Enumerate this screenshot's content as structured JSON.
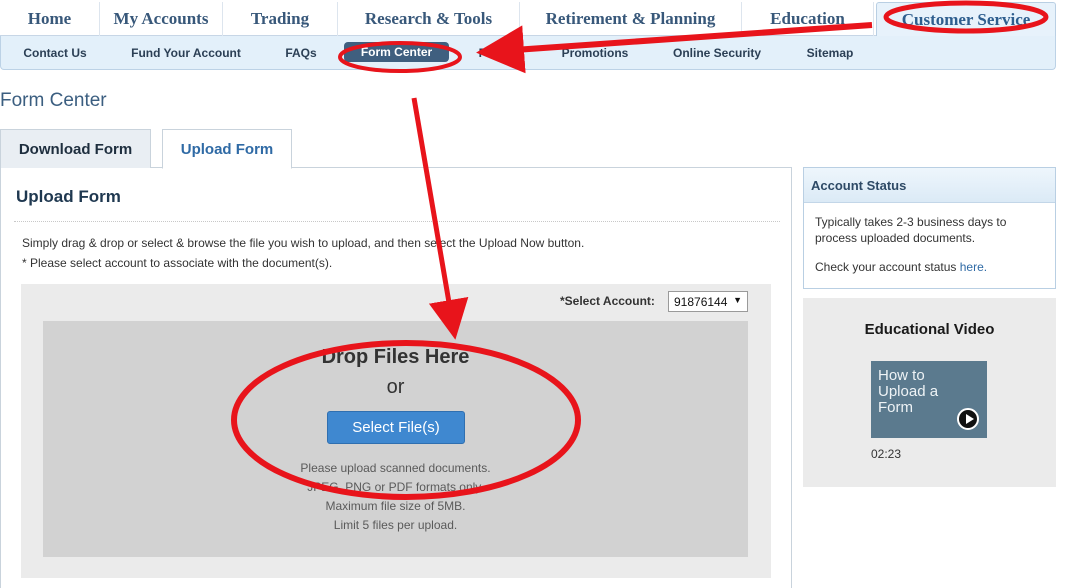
{
  "main_nav": {
    "items": [
      {
        "label": "Home"
      },
      {
        "label": "My Accounts"
      },
      {
        "label": "Trading"
      },
      {
        "label": "Research & Tools"
      },
      {
        "label": "Retirement & Planning"
      },
      {
        "label": "Education"
      },
      {
        "label": "Customer Service",
        "active": true
      }
    ]
  },
  "sub_nav": {
    "items": [
      {
        "label": "Contact Us"
      },
      {
        "label": "Fund Your Account"
      },
      {
        "label": "FAQs"
      },
      {
        "label": "Form Center",
        "active": true
      },
      {
        "label": "Pricing"
      },
      {
        "label": "Promotions"
      },
      {
        "label": "Online Security"
      },
      {
        "label": "Sitemap"
      }
    ]
  },
  "page": {
    "title": "Form Center",
    "tabs": [
      {
        "label": "Download Form"
      },
      {
        "label": "Upload Form",
        "active": true
      }
    ]
  },
  "upload": {
    "heading": "Upload Form",
    "instructions": [
      "Simply drag & drop or select & browse the file you wish to upload, and then select the Upload Now button.",
      "* Please select account to associate with the document(s)."
    ],
    "account_label": "*Select Account:",
    "account_value": "91876144",
    "drop_title": "Drop Files Here",
    "drop_or": "or",
    "select_button": "Select File(s)",
    "notes": [
      "Please upload scanned documents.",
      "JPEG, PNG or PDF formats only.",
      "Maximum file size of 5MB.",
      "Limit 5 files per upload."
    ]
  },
  "account_status": {
    "heading": "Account Status",
    "line1": "Typically takes 2-3 business days to",
    "line2": "process uploaded documents.",
    "check_text": "Check your account status ",
    "check_link": "here."
  },
  "video": {
    "heading": "Educational Video",
    "thumb_text": "How to Upload a Form",
    "duration": "02:23"
  },
  "annotation_color": "#e8141b",
  "icons": [
    "chevron-down-icon",
    "play-icon"
  ]
}
